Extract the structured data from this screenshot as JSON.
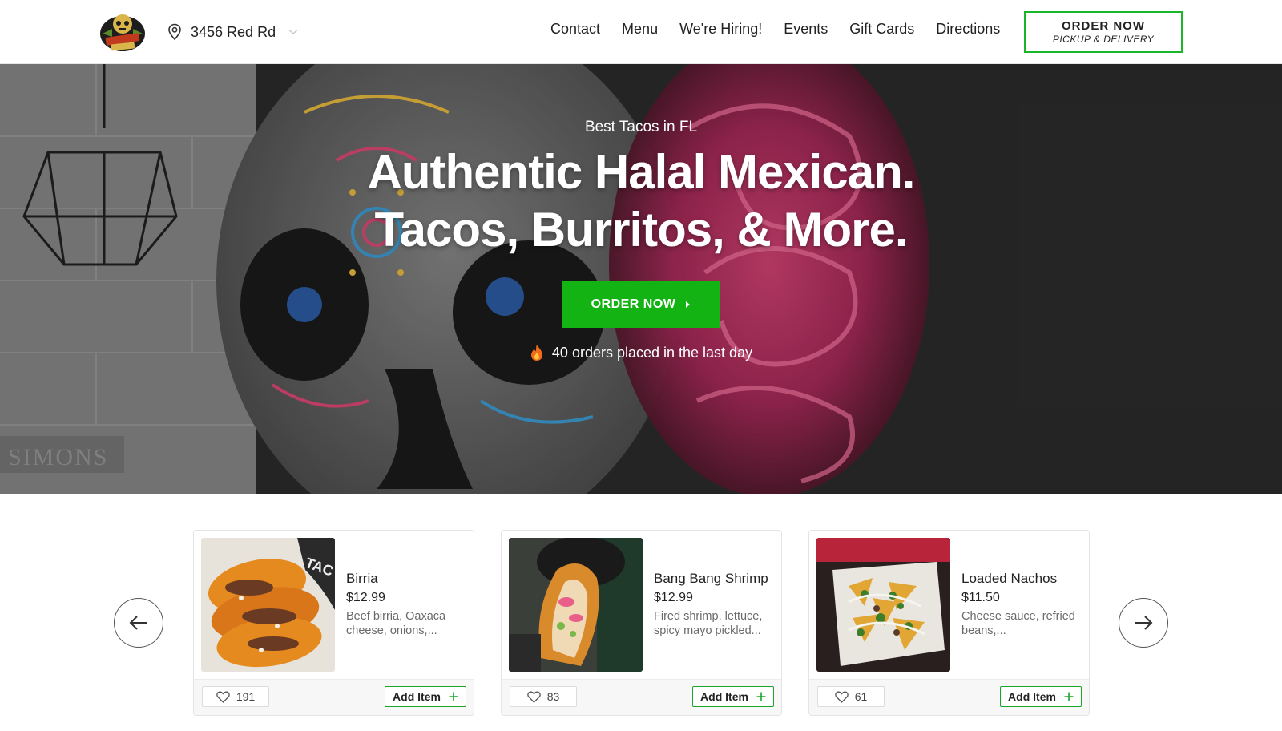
{
  "header": {
    "logo_alt": "Talkin' Tacos",
    "address": "3456 Red Rd",
    "nav": [
      "Contact",
      "Menu",
      "We're Hiring!",
      "Events",
      "Gift Cards",
      "Directions"
    ],
    "order_button": {
      "line1": "ORDER NOW",
      "line2": "PICKUP & DELIVERY"
    }
  },
  "hero": {
    "subtitle": "Best Tacos in FL",
    "title_line1": "Authentic Halal Mexican.",
    "title_line2": "Tacos, Burritos, & More.",
    "cta": "ORDER NOW",
    "orders_text": "40 orders placed in the last day",
    "mural_sign": "SIMONS"
  },
  "carousel": {
    "items": [
      {
        "name": "Birria",
        "price": "$12.99",
        "description": "Beef birria, Oaxaca cheese, onions,...",
        "likes": "191",
        "add_label": "Add Item"
      },
      {
        "name": "Bang Bang Shrimp",
        "price": "$12.99",
        "description": "Fired shrimp, lettuce, spicy mayo pickled...",
        "likes": "83",
        "add_label": "Add Item"
      },
      {
        "name": "Loaded Nachos",
        "price": "$11.50",
        "description": "Cheese sauce, refried beans,...",
        "likes": "61",
        "add_label": "Add Item"
      }
    ]
  },
  "colors": {
    "brand_green": "#12b312",
    "button_border_green": "#1bb52a"
  },
  "icons": [
    "location-pin-icon",
    "chevron-down-icon",
    "caret-right-icon",
    "fire-icon",
    "arrow-left-icon",
    "arrow-right-icon",
    "heart-icon",
    "plus-icon"
  ]
}
